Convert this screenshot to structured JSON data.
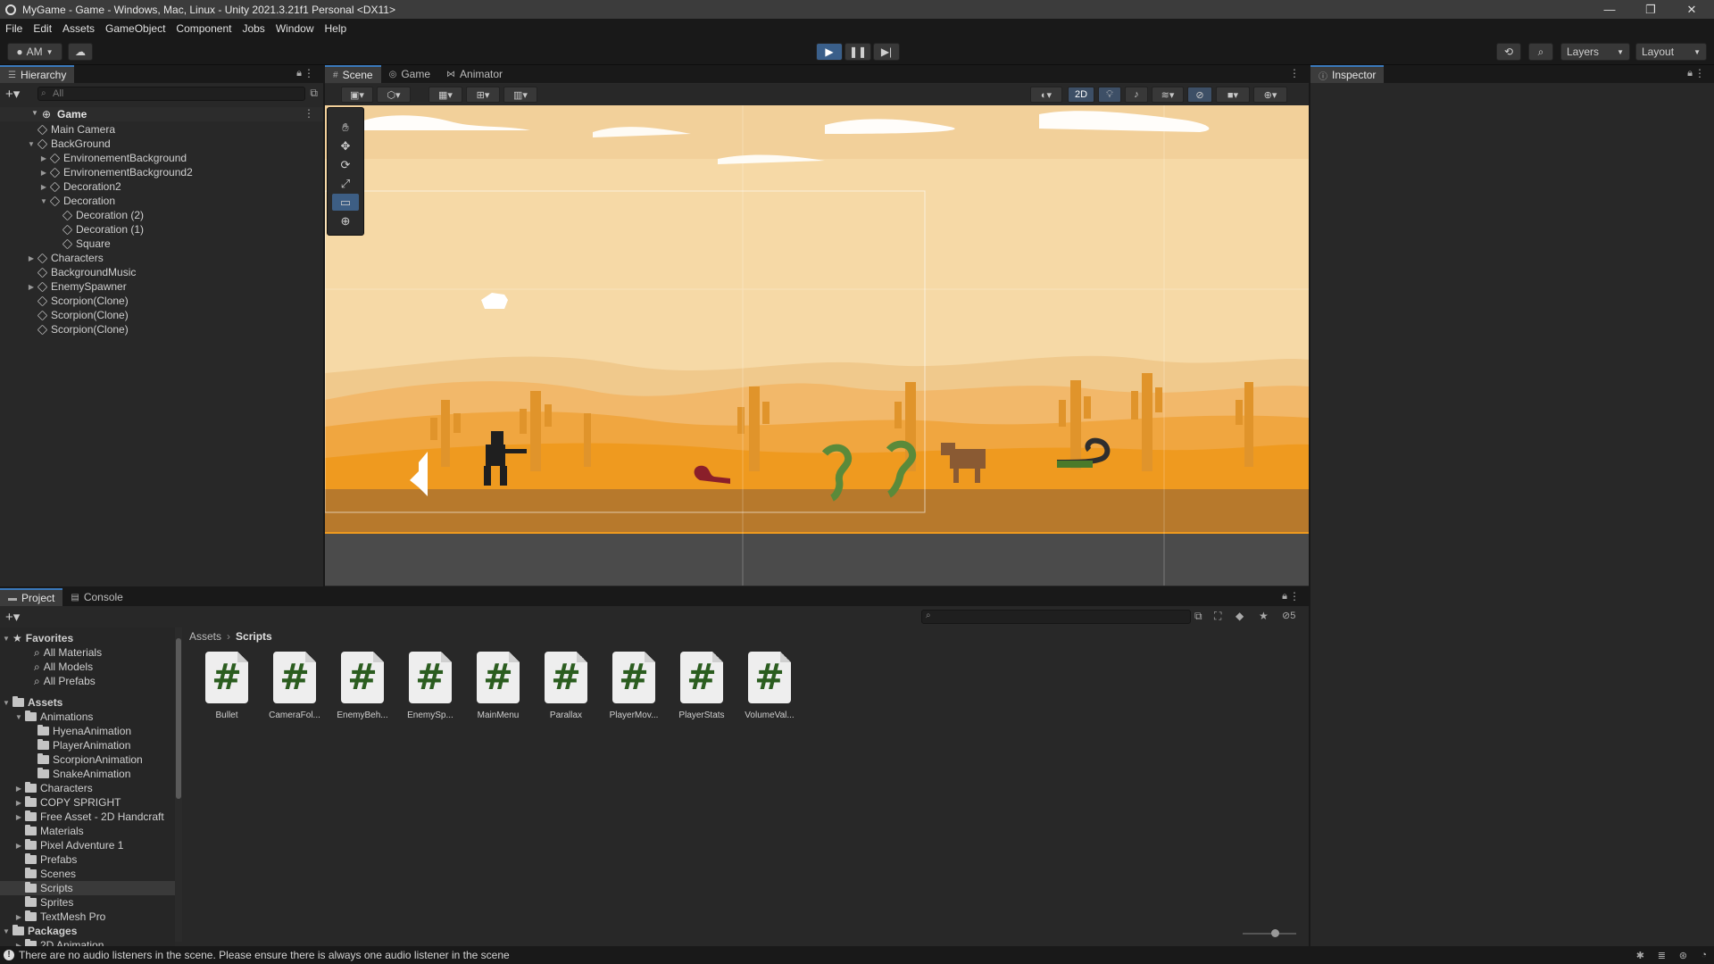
{
  "window": {
    "title": "MyGame - Game - Windows, Mac, Linux - Unity 2021.3.21f1 Personal <DX11>"
  },
  "menu": [
    "File",
    "Edit",
    "Assets",
    "GameObject",
    "Component",
    "Jobs",
    "Window",
    "Help"
  ],
  "toolbar": {
    "account": "AM",
    "layers": "Layers",
    "layout": "Layout"
  },
  "hierarchy": {
    "tab": "Hierarchy",
    "search_placeholder": "All",
    "scene": "Game",
    "items": [
      {
        "label": "Main Camera",
        "depth": 1,
        "arrow": ""
      },
      {
        "label": "BackGround",
        "depth": 1,
        "arrow": "▼"
      },
      {
        "label": "EnvironementBackground",
        "depth": 2,
        "arrow": "▶"
      },
      {
        "label": "EnvironementBackground2",
        "depth": 2,
        "arrow": "▶"
      },
      {
        "label": "Decoration2",
        "depth": 2,
        "arrow": "▶"
      },
      {
        "label": "Decoration",
        "depth": 2,
        "arrow": "▼"
      },
      {
        "label": "Decoration (2)",
        "depth": 3,
        "arrow": ""
      },
      {
        "label": "Decoration (1)",
        "depth": 3,
        "arrow": ""
      },
      {
        "label": "Square",
        "depth": 3,
        "arrow": ""
      },
      {
        "label": "Characters",
        "depth": 1,
        "arrow": "▶"
      },
      {
        "label": "BackgroundMusic",
        "depth": 1,
        "arrow": ""
      },
      {
        "label": "EnemySpawner",
        "depth": 1,
        "arrow": "▶"
      },
      {
        "label": "Scorpion(Clone)",
        "depth": 1,
        "arrow": ""
      },
      {
        "label": "Scorpion(Clone)",
        "depth": 1,
        "arrow": ""
      },
      {
        "label": "Scorpion(Clone)",
        "depth": 1,
        "arrow": ""
      }
    ]
  },
  "center_tabs": [
    "Scene",
    "Game",
    "Animator"
  ],
  "scene_toolbar": {
    "mode_2d": "2D"
  },
  "inspector": {
    "tab": "Inspector"
  },
  "bottom_tabs": [
    "Project",
    "Console"
  ],
  "project": {
    "favorites_label": "Favorites",
    "favorites": [
      "All Materials",
      "All Models",
      "All Prefabs"
    ],
    "assets_label": "Assets",
    "tree": [
      {
        "label": "Animations",
        "depth": 1,
        "arrow": "▼"
      },
      {
        "label": "HyenaAnimation",
        "depth": 2,
        "arrow": ""
      },
      {
        "label": "PlayerAnimation",
        "depth": 2,
        "arrow": ""
      },
      {
        "label": "ScorpionAnimation",
        "depth": 2,
        "arrow": ""
      },
      {
        "label": "SnakeAnimation",
        "depth": 2,
        "arrow": ""
      },
      {
        "label": "Characters",
        "depth": 1,
        "arrow": "▶"
      },
      {
        "label": "COPY SPRIGHT",
        "depth": 1,
        "arrow": "▶"
      },
      {
        "label": "Free Asset - 2D Handcraft",
        "depth": 1,
        "arrow": "▶"
      },
      {
        "label": "Materials",
        "depth": 1,
        "arrow": ""
      },
      {
        "label": "Pixel Adventure 1",
        "depth": 1,
        "arrow": "▶"
      },
      {
        "label": "Prefabs",
        "depth": 1,
        "arrow": ""
      },
      {
        "label": "Scenes",
        "depth": 1,
        "arrow": ""
      },
      {
        "label": "Scripts",
        "depth": 1,
        "arrow": "",
        "selected": true
      },
      {
        "label": "Sprites",
        "depth": 1,
        "arrow": ""
      },
      {
        "label": "TextMesh Pro",
        "depth": 1,
        "arrow": "▶"
      }
    ],
    "packages_label": "Packages",
    "packages_first": "2D Animation",
    "breadcrumb": [
      "Assets",
      "Scripts"
    ],
    "hidden_count": "5",
    "assets": [
      "Bullet",
      "CameraFol...",
      "EnemyBeh...",
      "EnemySp...",
      "MainMenu",
      "Parallax",
      "PlayerMov...",
      "PlayerStats",
      "VolumeVal..."
    ]
  },
  "status": {
    "message": "There are no audio listeners in the scene. Please ensure there is always one audio listener in the scene"
  },
  "colors": {
    "accent": "#3a79bb",
    "sky": "#f6d9a6",
    "desert": "#ef9a1f",
    "ground": "#b7792c"
  }
}
